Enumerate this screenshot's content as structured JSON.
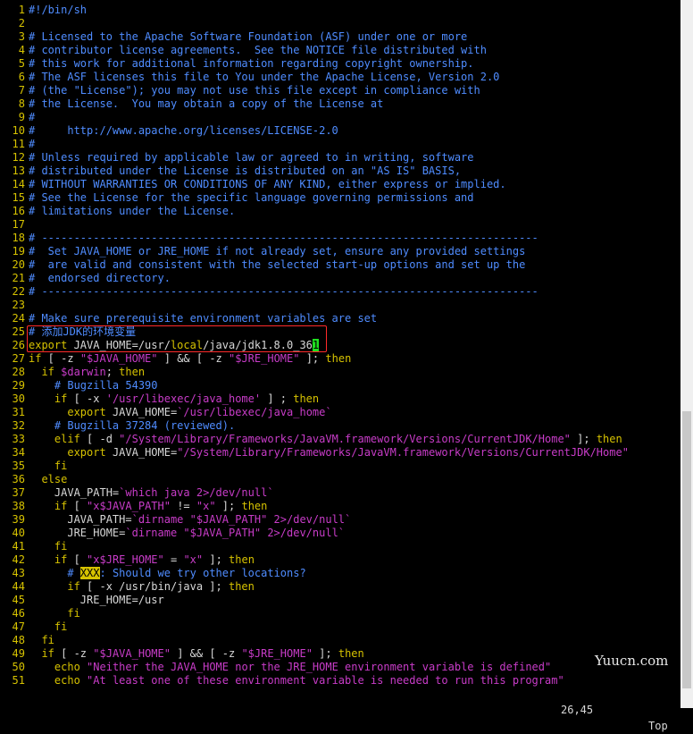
{
  "lines": [
    {
      "n": "1",
      "s": [
        [
          "c-cmt",
          "#!/bin/sh"
        ]
      ]
    },
    {
      "n": "2",
      "s": []
    },
    {
      "n": "3",
      "s": [
        [
          "c-cmt",
          "# Licensed to the Apache Software Foundation (ASF) under one or more"
        ]
      ]
    },
    {
      "n": "4",
      "s": [
        [
          "c-cmt",
          "# contributor license agreements.  See the NOTICE file distributed with"
        ]
      ]
    },
    {
      "n": "5",
      "s": [
        [
          "c-cmt",
          "# this work for additional information regarding copyright ownership."
        ]
      ]
    },
    {
      "n": "6",
      "s": [
        [
          "c-cmt",
          "# The ASF licenses this file to You under the Apache License, Version 2.0"
        ]
      ]
    },
    {
      "n": "7",
      "s": [
        [
          "c-cmt",
          "# (the \"License\"); you may not use this file except in compliance with"
        ]
      ]
    },
    {
      "n": "8",
      "s": [
        [
          "c-cmt",
          "# the License.  You may obtain a copy of the License at"
        ]
      ]
    },
    {
      "n": "9",
      "s": [
        [
          "c-cmt",
          "#"
        ]
      ]
    },
    {
      "n": "10",
      "s": [
        [
          "c-cmt",
          "#     http://www.apache.org/licenses/LICENSE-2.0"
        ]
      ]
    },
    {
      "n": "11",
      "s": [
        [
          "c-cmt",
          "#"
        ]
      ]
    },
    {
      "n": "12",
      "s": [
        [
          "c-cmt",
          "# Unless required by applicable law or agreed to in writing, software"
        ]
      ]
    },
    {
      "n": "13",
      "s": [
        [
          "c-cmt",
          "# distributed under the License is distributed on an \"AS IS\" BASIS,"
        ]
      ]
    },
    {
      "n": "14",
      "s": [
        [
          "c-cmt",
          "# WITHOUT WARRANTIES OR CONDITIONS OF ANY KIND, either express or implied."
        ]
      ]
    },
    {
      "n": "15",
      "s": [
        [
          "c-cmt",
          "# See the License for the specific language governing permissions and"
        ]
      ]
    },
    {
      "n": "16",
      "s": [
        [
          "c-cmt",
          "# limitations under the License."
        ]
      ]
    },
    {
      "n": "17",
      "s": []
    },
    {
      "n": "18",
      "s": [
        [
          "c-cmt",
          "# -----------------------------------------------------------------------------"
        ]
      ]
    },
    {
      "n": "19",
      "s": [
        [
          "c-cmt",
          "#  Set JAVA_HOME or JRE_HOME if not already set, ensure any provided settings"
        ]
      ]
    },
    {
      "n": "20",
      "s": [
        [
          "c-cmt",
          "#  are valid and consistent with the selected start-up options and set up the"
        ]
      ]
    },
    {
      "n": "21",
      "s": [
        [
          "c-cmt",
          "#  endorsed directory."
        ]
      ]
    },
    {
      "n": "22",
      "s": [
        [
          "c-cmt",
          "# -----------------------------------------------------------------------------"
        ]
      ]
    },
    {
      "n": "23",
      "s": []
    },
    {
      "n": "24",
      "s": [
        [
          "c-cmt",
          "# Make sure prerequisite environment variables are set"
        ]
      ]
    },
    {
      "n": "25",
      "s": [
        [
          "c-cmt",
          "# 添加JDK的环境变量"
        ]
      ]
    },
    {
      "n": "26",
      "s": [
        [
          "c-kw",
          "export"
        ],
        [
          "c-txt",
          " JAVA_HOME=/usr/"
        ],
        [
          "c-kw",
          "local"
        ],
        [
          "c-txt",
          "/java/jdk1.8.0_36"
        ],
        [
          "cursor",
          "1"
        ]
      ]
    },
    {
      "n": "27",
      "s": [
        [
          "c-kw",
          "if"
        ],
        [
          "c-txt",
          " [ -z "
        ],
        [
          "c-str",
          "\"$JAVA_HOME\""
        ],
        [
          "c-txt",
          " ] && [ -z "
        ],
        [
          "c-str",
          "\"$JRE_HOME\""
        ],
        [
          "c-txt",
          " ]; "
        ],
        [
          "c-kw",
          "then"
        ]
      ]
    },
    {
      "n": "28",
      "s": [
        [
          "c-txt",
          "  "
        ],
        [
          "c-kw",
          "if"
        ],
        [
          "c-txt",
          " "
        ],
        [
          "c-var",
          "$darwin"
        ],
        [
          "c-txt",
          "; "
        ],
        [
          "c-kw",
          "then"
        ]
      ]
    },
    {
      "n": "29",
      "s": [
        [
          "c-txt",
          "    "
        ],
        [
          "c-cmt",
          "# Bugzilla 54390"
        ]
      ]
    },
    {
      "n": "30",
      "s": [
        [
          "c-txt",
          "    "
        ],
        [
          "c-kw",
          "if"
        ],
        [
          "c-txt",
          " [ -x "
        ],
        [
          "c-str",
          "'/usr/libexec/java_home'"
        ],
        [
          "c-txt",
          " ] ; "
        ],
        [
          "c-kw",
          "then"
        ]
      ]
    },
    {
      "n": "31",
      "s": [
        [
          "c-txt",
          "      "
        ],
        [
          "c-kw",
          "export"
        ],
        [
          "c-txt",
          " JAVA_HOME="
        ],
        [
          "c-str",
          "`/usr/libexec/java_home`"
        ]
      ]
    },
    {
      "n": "32",
      "s": [
        [
          "c-txt",
          "    "
        ],
        [
          "c-cmt",
          "# Bugzilla 37284 (reviewed)."
        ]
      ]
    },
    {
      "n": "33",
      "s": [
        [
          "c-txt",
          "    "
        ],
        [
          "c-kw",
          "elif"
        ],
        [
          "c-txt",
          " [ -d "
        ],
        [
          "c-str",
          "\"/System/Library/Frameworks/JavaVM.framework/Versions/CurrentJDK/Home\""
        ],
        [
          "c-txt",
          " ]; "
        ],
        [
          "c-kw",
          "then"
        ]
      ]
    },
    {
      "n": "34",
      "s": [
        [
          "c-txt",
          "      "
        ],
        [
          "c-kw",
          "export"
        ],
        [
          "c-txt",
          " JAVA_HOME="
        ],
        [
          "c-str",
          "\"/System/Library/Frameworks/JavaVM.framework/Versions/CurrentJDK/Home\""
        ]
      ]
    },
    {
      "n": "35",
      "s": [
        [
          "c-txt",
          "    "
        ],
        [
          "c-kw",
          "fi"
        ]
      ]
    },
    {
      "n": "36",
      "s": [
        [
          "c-txt",
          "  "
        ],
        [
          "c-kw",
          "else"
        ]
      ]
    },
    {
      "n": "37",
      "s": [
        [
          "c-txt",
          "    JAVA_PATH="
        ],
        [
          "c-str",
          "`which java 2>/dev/null`"
        ]
      ]
    },
    {
      "n": "38",
      "s": [
        [
          "c-txt",
          "    "
        ],
        [
          "c-kw",
          "if"
        ],
        [
          "c-txt",
          " [ "
        ],
        [
          "c-str",
          "\"x$JAVA_PATH\""
        ],
        [
          "c-txt",
          " != "
        ],
        [
          "c-str",
          "\"x\""
        ],
        [
          "c-txt",
          " ]; "
        ],
        [
          "c-kw",
          "then"
        ]
      ]
    },
    {
      "n": "39",
      "s": [
        [
          "c-txt",
          "      JAVA_PATH="
        ],
        [
          "c-str",
          "`dirname "
        ],
        [
          "c-str",
          "\"$JAVA_PATH\""
        ],
        [
          "c-str",
          " 2>/dev/null`"
        ]
      ]
    },
    {
      "n": "40",
      "s": [
        [
          "c-txt",
          "      JRE_HOME="
        ],
        [
          "c-str",
          "`dirname "
        ],
        [
          "c-str",
          "\"$JAVA_PATH\""
        ],
        [
          "c-str",
          " 2>/dev/null`"
        ]
      ]
    },
    {
      "n": "41",
      "s": [
        [
          "c-txt",
          "    "
        ],
        [
          "c-kw",
          "fi"
        ]
      ]
    },
    {
      "n": "42",
      "s": [
        [
          "c-txt",
          "    "
        ],
        [
          "c-kw",
          "if"
        ],
        [
          "c-txt",
          " [ "
        ],
        [
          "c-str",
          "\"x$JRE_HOME\""
        ],
        [
          "c-txt",
          " = "
        ],
        [
          "c-str",
          "\"x\""
        ],
        [
          "c-txt",
          " ]; "
        ],
        [
          "c-kw",
          "then"
        ]
      ]
    },
    {
      "n": "43",
      "s": [
        [
          "c-txt",
          "      "
        ],
        [
          "c-cmt",
          "# "
        ],
        [
          "c-todo",
          "XXX"
        ],
        [
          "c-cmt",
          ": Should we try other locations?"
        ]
      ]
    },
    {
      "n": "44",
      "s": [
        [
          "c-txt",
          "      "
        ],
        [
          "c-kw",
          "if"
        ],
        [
          "c-txt",
          " [ -x /usr/bin/java ]; "
        ],
        [
          "c-kw",
          "then"
        ]
      ]
    },
    {
      "n": "45",
      "s": [
        [
          "c-txt",
          "        JRE_HOME=/usr"
        ]
      ]
    },
    {
      "n": "46",
      "s": [
        [
          "c-txt",
          "      "
        ],
        [
          "c-kw",
          "fi"
        ]
      ]
    },
    {
      "n": "47",
      "s": [
        [
          "c-txt",
          "    "
        ],
        [
          "c-kw",
          "fi"
        ]
      ]
    },
    {
      "n": "48",
      "s": [
        [
          "c-txt",
          "  "
        ],
        [
          "c-kw",
          "fi"
        ]
      ]
    },
    {
      "n": "49",
      "s": [
        [
          "c-txt",
          "  "
        ],
        [
          "c-kw",
          "if"
        ],
        [
          "c-txt",
          " [ -z "
        ],
        [
          "c-str",
          "\"$JAVA_HOME\""
        ],
        [
          "c-txt",
          " ] && [ -z "
        ],
        [
          "c-str",
          "\"$JRE_HOME\""
        ],
        [
          "c-txt",
          " ]; "
        ],
        [
          "c-kw",
          "then"
        ]
      ]
    },
    {
      "n": "50",
      "s": [
        [
          "c-txt",
          "    "
        ],
        [
          "c-kw",
          "echo"
        ],
        [
          "c-txt",
          " "
        ],
        [
          "c-str",
          "\"Neither the JAVA_HOME nor the JRE_HOME environment variable is defined\""
        ]
      ]
    },
    {
      "n": "51",
      "s": [
        [
          "c-txt",
          "    "
        ],
        [
          "c-kw",
          "echo"
        ],
        [
          "c-txt",
          " "
        ],
        [
          "c-str",
          "\"At least one of these environment variable is needed to run this program\""
        ]
      ]
    }
  ],
  "status": {
    "position": "26,45",
    "scroll": "Top"
  },
  "watermark": "Yuucn.com",
  "colors": {
    "background": "#000000",
    "comment": "#4f8cff",
    "keyword": "#d6c200",
    "string": "#c83cc8",
    "highlight_box": "#ff2a2a"
  }
}
